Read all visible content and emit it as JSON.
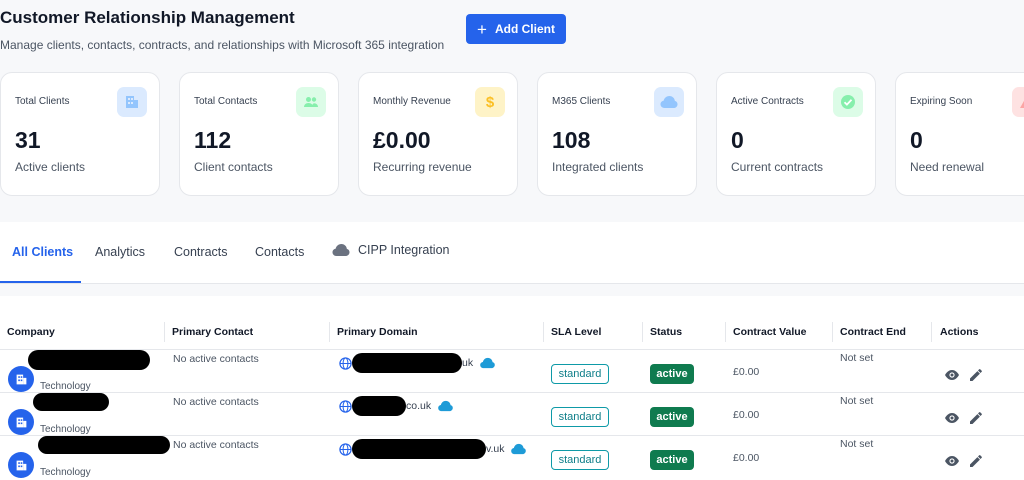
{
  "header": {
    "title": "Customer Relationship Management",
    "subtitle": "Manage clients, contacts, contracts, and relationships with Microsoft 365 integration",
    "add_button_label": "Add Client"
  },
  "stats": [
    {
      "label": "Total Clients",
      "value": "31",
      "sub": "Active clients",
      "icon": "building-icon",
      "icon_bg": "#dbeafe",
      "icon_color": "#93c5fd"
    },
    {
      "label": "Total Contacts",
      "value": "112",
      "sub": "Client contacts",
      "icon": "people-icon",
      "icon_bg": "#dcfce7",
      "icon_color": "#86efac"
    },
    {
      "label": "Monthly Revenue",
      "value": "£0.00",
      "sub": "Recurring revenue",
      "icon": "dollar-icon",
      "icon_bg": "#fef3c7",
      "icon_color": "#fcd34d"
    },
    {
      "label": "M365 Clients",
      "value": "108",
      "sub": "Integrated clients",
      "icon": "cloud-icon",
      "icon_bg": "#dbeafe",
      "icon_color": "#93c5fd"
    },
    {
      "label": "Active Contracts",
      "value": "0",
      "sub": "Current contracts",
      "icon": "check-circle-icon",
      "icon_bg": "#dcfce7",
      "icon_color": "#86efac"
    },
    {
      "label": "Expiring Soon",
      "value": "0",
      "sub": "Need renewal",
      "icon": "warning-icon",
      "icon_bg": "#fee2e2",
      "icon_color": "#fca5a5"
    }
  ],
  "tabs": [
    {
      "label": "All Clients",
      "active": true
    },
    {
      "label": "Analytics",
      "active": false
    },
    {
      "label": "Contracts",
      "active": false
    },
    {
      "label": "Contacts",
      "active": false
    },
    {
      "label": "CIPP Integration",
      "active": false
    }
  ],
  "table": {
    "columns": [
      "Company",
      "Primary Contact",
      "Primary Domain",
      "SLA Level",
      "Status",
      "Contract Value",
      "Contract End",
      "Actions"
    ],
    "rows": [
      {
        "industry": "Technology",
        "primary_contact": "No active contacts",
        "domain_suffix": "uk",
        "sla": "standard",
        "status": "active",
        "contract_value": "£0.00",
        "contract_end": "Not set"
      },
      {
        "industry": "Technology",
        "primary_contact": "No active contacts",
        "domain_suffix": "co.uk",
        "sla": "standard",
        "status": "active",
        "contract_value": "£0.00",
        "contract_end": "Not set"
      },
      {
        "industry": "Technology",
        "primary_contact": "No active contacts",
        "domain_suffix": "v.uk",
        "sla": "standard",
        "status": "active",
        "contract_value": "£0.00",
        "contract_end": "Not set"
      }
    ]
  },
  "colors": {
    "accent": "#2563eb",
    "status_active": "#0f7b4f",
    "sla_teal": "#0e9aa7",
    "cloud_icon": "#1e9bd7"
  }
}
